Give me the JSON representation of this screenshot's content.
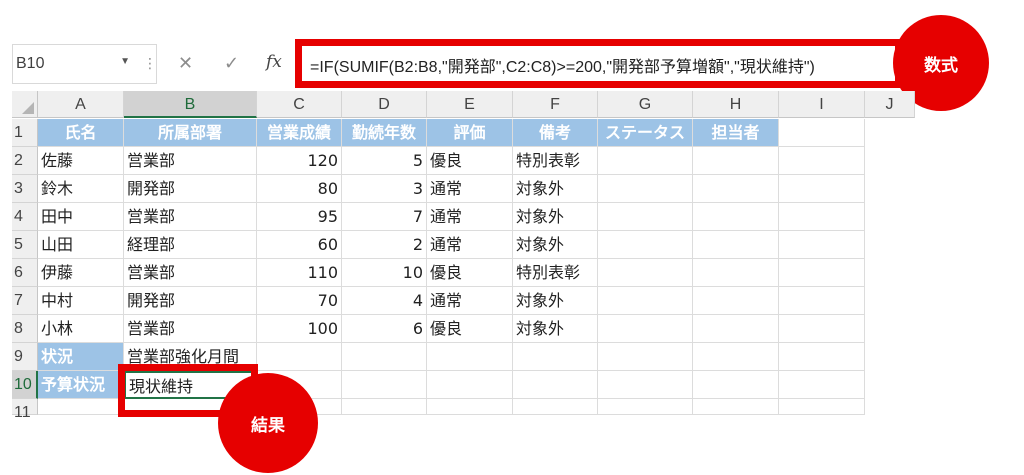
{
  "name_box": "B10",
  "formula_bar": {
    "cancel_icon": "✕",
    "enter_icon": "✓",
    "fx_label": "fx",
    "formula": "=IF(SUMIF(B2:B8,\"開発部\",C2:C8)>=200,\"開発部予算増額\",\"現状維持\")"
  },
  "callouts": {
    "formula": "数式",
    "result": "結果"
  },
  "accent_color": "#e60000",
  "header_fill": "#9dc3e6",
  "columns": [
    "A",
    "B",
    "C",
    "D",
    "E",
    "F",
    "G",
    "H",
    "I",
    "J"
  ],
  "rows": [
    "1",
    "2",
    "3",
    "4",
    "5",
    "6",
    "7",
    "8",
    "9",
    "10",
    "11"
  ],
  "table": {
    "headers": [
      "氏名",
      "所属部署",
      "営業成績",
      "勤続年数",
      "評価",
      "備考",
      "ステータス",
      "担当者"
    ],
    "records": [
      [
        "佐藤",
        "営業部",
        "120",
        "5",
        "優良",
        "特別表彰"
      ],
      [
        "鈴木",
        "開発部",
        "80",
        "3",
        "通常",
        "対象外"
      ],
      [
        "田中",
        "営業部",
        "95",
        "7",
        "通常",
        "対象外"
      ],
      [
        "山田",
        "経理部",
        "60",
        "2",
        "通常",
        "対象外"
      ],
      [
        "伊藤",
        "営業部",
        "110",
        "10",
        "優良",
        "特別表彰"
      ],
      [
        "中村",
        "開発部",
        "70",
        "4",
        "通常",
        "対象外"
      ],
      [
        "小林",
        "営業部",
        "100",
        "6",
        "優良",
        "対象外"
      ]
    ]
  },
  "status_row": {
    "label": "状況",
    "value": "営業部強化月間"
  },
  "budget_row": {
    "label": "予算状況",
    "value": "現状維持"
  }
}
